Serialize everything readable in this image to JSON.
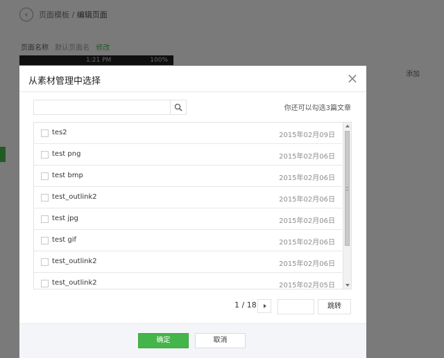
{
  "background": {
    "breadcrumb_parent": "页面模板",
    "breadcrumb_sep": "/",
    "breadcrumb_current": "编辑页面",
    "name_label": "页面名称",
    "name_value": "默认页面名",
    "edit_link": "修改",
    "phone_time": "1:21 PM",
    "phone_battery": "100%",
    "add_label": "添加"
  },
  "dialog": {
    "title": "从素材管理中选择",
    "close": "×",
    "search_placeholder": "",
    "hint": "你还可以勾选3篇文章",
    "items": [
      {
        "title": "tes2",
        "date": "2015年02月09日"
      },
      {
        "title": "test png",
        "date": "2015年02月06日"
      },
      {
        "title": "test bmp",
        "date": "2015年02月06日"
      },
      {
        "title": "test_outlink2",
        "date": "2015年02月06日"
      },
      {
        "title": "test jpg",
        "date": "2015年02月06日"
      },
      {
        "title": "test gif",
        "date": "2015年02月06日"
      },
      {
        "title": "test_outlink2",
        "date": "2015年02月06日"
      },
      {
        "title": "test_outlink2",
        "date": "2015年02月05日"
      }
    ],
    "pagination": {
      "text": "1 / 18",
      "page_input": "",
      "jump_label": "跳转"
    },
    "ok_label": "确定",
    "cancel_label": "取消"
  },
  "colors": {
    "accent": "#44b549",
    "overlay": "rgba(0,0,0,0.5)"
  }
}
